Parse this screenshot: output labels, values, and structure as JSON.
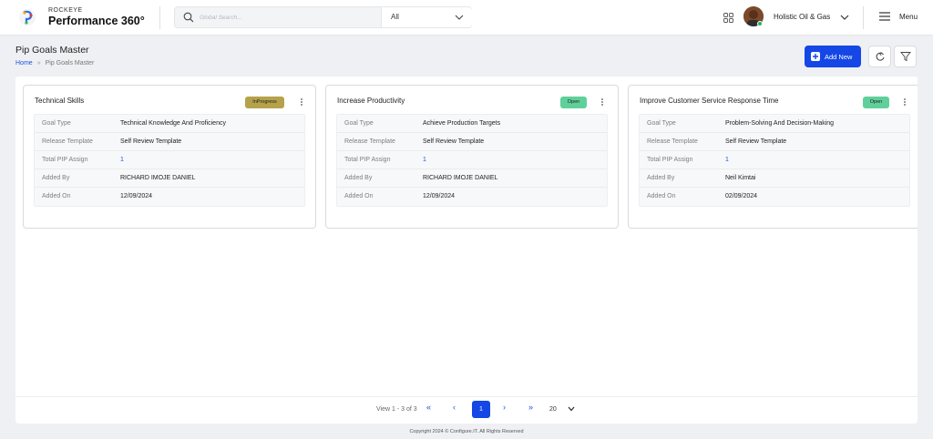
{
  "header": {
    "brand_small": "ROCKEYE",
    "brand_big": "Performance 360°",
    "search_placeholder": "Global Search...",
    "search_scope": "All",
    "org_name": "Holistic Oil & Gas",
    "menu_label": "Menu"
  },
  "page": {
    "title": "Pip Goals Master",
    "breadcrumb_home": "Home",
    "breadcrumb_sep": "»",
    "breadcrumb_current": "Pip Goals Master",
    "add_new_label": "Add New"
  },
  "row_labels": {
    "goal_type": "Goal Type",
    "release_template": "Release Template",
    "total_pip_assign": "Total PIP Assign",
    "added_by": "Added By",
    "added_on": "Added On"
  },
  "cards": [
    {
      "title": "Technical Skills",
      "status": "InProgress",
      "status_color": "#b5a24a",
      "goal_type": "Technical Knowledge And Proficiency",
      "release_template": "Self Review Template",
      "total_pip_assign": "1",
      "added_by": "RICHARD IMOJE DANIEL",
      "added_on": "12/09/2024"
    },
    {
      "title": "Increase Productivity",
      "status": "Open",
      "status_color": "#5fd09a",
      "goal_type": "Achieve Production Targets",
      "release_template": "Self Review Template",
      "total_pip_assign": "1",
      "added_by": "RICHARD IMOJE DANIEL",
      "added_on": "12/09/2024"
    },
    {
      "title": "Improve Customer Service Response Time",
      "status": "Open",
      "status_color": "#5fd09a",
      "goal_type": "Problem-Solving And Decision-Making",
      "release_template": "Self Review Template",
      "total_pip_assign": "1",
      "added_by": "Neil Kimtai",
      "added_on": "02/09/2024"
    }
  ],
  "pagination": {
    "view_text": "View 1 - 3 of 3",
    "first": "«",
    "prev": "‹",
    "current_page": "1",
    "next": "›",
    "last": "»",
    "page_size": "20"
  },
  "footer": {
    "copyright": "Copyright 2024 © Configure.IT. All Rights Reserved"
  },
  "colors": {
    "primary": "#1447e6",
    "link": "#1a56db",
    "background": "#eef0f3"
  }
}
